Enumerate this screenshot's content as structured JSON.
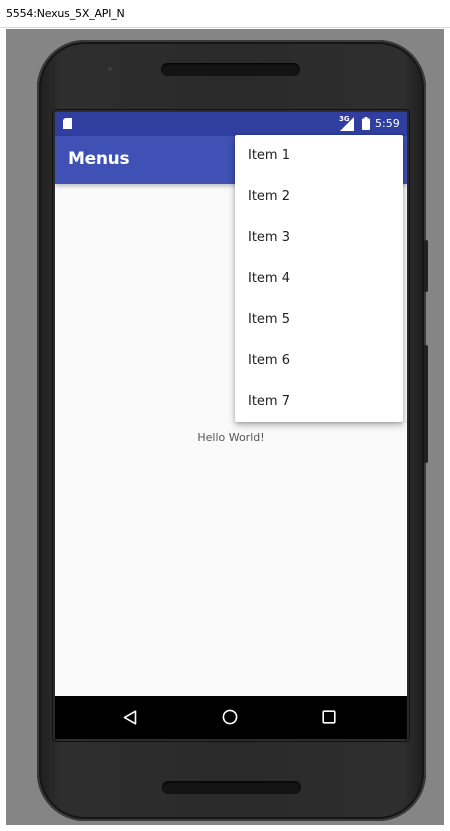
{
  "window": {
    "title": "5554:Nexus_5X_API_N"
  },
  "status_bar": {
    "network": "3G",
    "time": "5:59",
    "icons": [
      "sd-card-icon",
      "signal-icon",
      "battery-icon"
    ]
  },
  "app_bar": {
    "title": "Menus"
  },
  "content": {
    "hello_text": "Hello World!"
  },
  "overflow_menu": {
    "items": [
      "Item 1",
      "Item 2",
      "Item 3",
      "Item 4",
      "Item 5",
      "Item 6",
      "Item 7"
    ]
  },
  "nav_bar": {
    "buttons": [
      "back-icon",
      "home-icon",
      "recents-icon"
    ]
  },
  "colors": {
    "status_bar": "#303f9f",
    "app_bar": "#3f51b5",
    "screen_bg": "#fafafa",
    "emulator_bg": "#858585"
  }
}
